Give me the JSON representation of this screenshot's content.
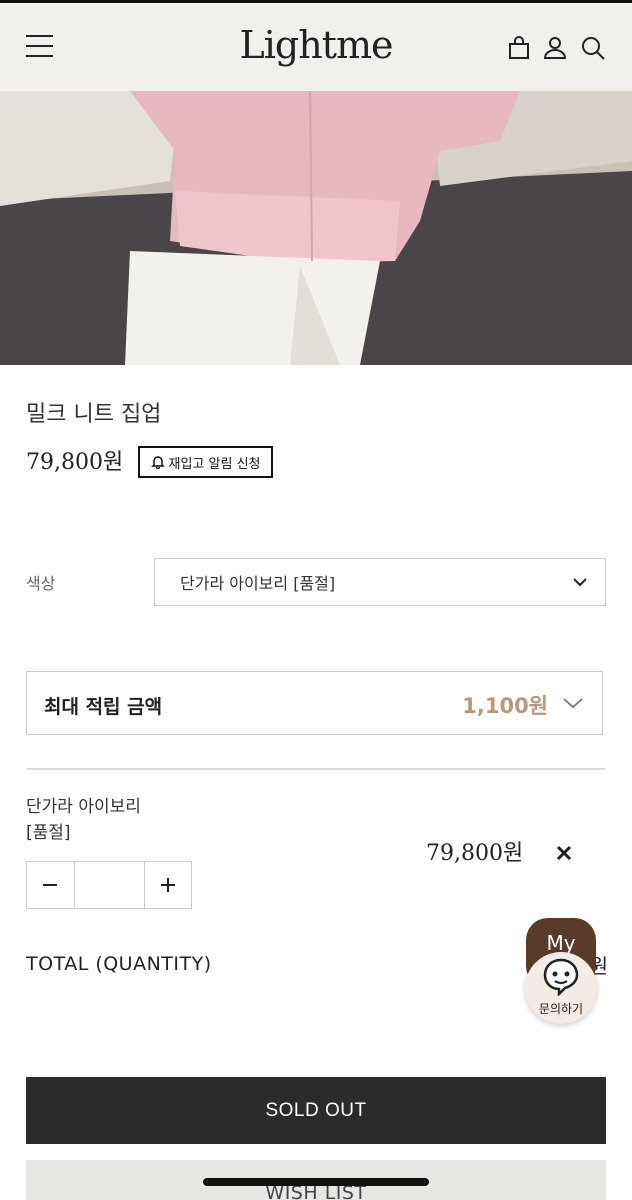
{
  "header": {
    "logo": "Lightme",
    "icons": [
      "menu-icon",
      "shopping-bag-icon",
      "user-icon",
      "search-icon"
    ]
  },
  "product": {
    "name": "밀크 니트 집업",
    "price": "79,800원",
    "restock_label": "재입고 알림 신청"
  },
  "options": {
    "color_label": "색상",
    "color_selected": "단가라 아이보리 [품절]"
  },
  "reward": {
    "label": "최대 적립 금액",
    "amount": "1,100원",
    "amount_color": "#b49a80"
  },
  "selected_item": {
    "name_line1": "단가라 아이보리",
    "name_line2": "[품절]",
    "price": "79,800원",
    "quantity": ""
  },
  "total": {
    "label": "TOTAL (QUANTITY)",
    "amount": "원"
  },
  "floating": {
    "my_label": "My",
    "chat_label": "문의하기"
  },
  "buttons": {
    "sold_out": "SOLD OUT",
    "wish_list": "WISH LIST"
  }
}
